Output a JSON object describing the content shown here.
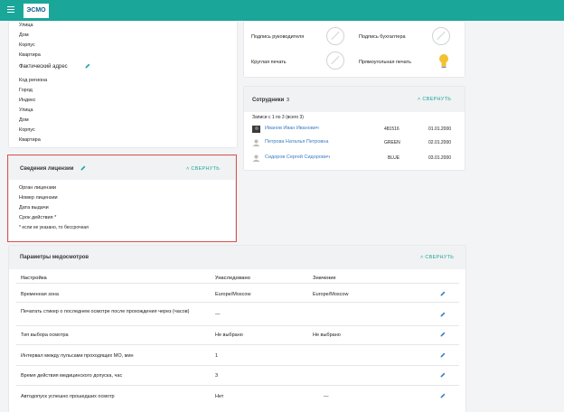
{
  "app": {
    "logo_text": "ЭСМО"
  },
  "address_block": {
    "top_items": [
      "Улица",
      "Дом",
      "Корпус",
      "Квартира"
    ],
    "actual_title": "Фактический адрес",
    "actual_items": [
      "Код региона",
      "Город",
      "Индекс",
      "Улица",
      "Дом",
      "Корпус",
      "Квартира"
    ]
  },
  "signatures": {
    "director_sign": "Подпись руководителя",
    "accountant_sign": "Подпись бухгалтера",
    "round_stamp": "Круглая печать",
    "rect_stamp": "Прямоугольная печать"
  },
  "employees": {
    "title": "Сотрудники",
    "count": "3",
    "collapse": "СВЕРНУТЬ",
    "records": "Записи с 1 по 3 (всего 3)",
    "rows": [
      {
        "name": "Иванов Иван Иванович",
        "code": "481516",
        "date": "01.01.2000"
      },
      {
        "name": "Петрова Наталья Петровна",
        "code": "GREEN",
        "date": "02.01.2000"
      },
      {
        "name": "Сидоров Сергей Сидорович",
        "code": "BLUE",
        "date": "03.01.2000"
      }
    ]
  },
  "license": {
    "title": "Сведения лицензии",
    "collapse": "СВЕРНУТЬ",
    "items": [
      "Орган лицензии",
      "Номер лицензии",
      "Дата выдачи",
      "Срок действия *"
    ],
    "note": "* если не указано, то бессрочная"
  },
  "medical": {
    "title": "Параметры медосмотров",
    "collapse": "СВЕРНУТЬ",
    "col_setting": "Настройка",
    "col_inherited": "Унаследовано",
    "col_value": "Значение",
    "rows": [
      {
        "setting": "Временная зона",
        "inherited": "Europe/Moscow",
        "value": "Europe/Moscow"
      },
      {
        "setting": "Печатать стикер о последнем осмотре после прохождения через (часов)",
        "setting2": "",
        "inherited": "—",
        "value": ""
      },
      {
        "setting": "Тип выбора осмотра",
        "inherited": "Не выбрано",
        "value": "Не выбрано"
      },
      {
        "setting": "Интервал между пульсами проходящих МО, мин",
        "inherited": "1",
        "value": ""
      },
      {
        "setting": "Время действия медицинского допуска, час",
        "inherited": "3",
        "value": ""
      },
      {
        "setting": "Автодопуск успешно прошедших осмотр",
        "inherited": "Нет",
        "value": "—"
      }
    ]
  }
}
